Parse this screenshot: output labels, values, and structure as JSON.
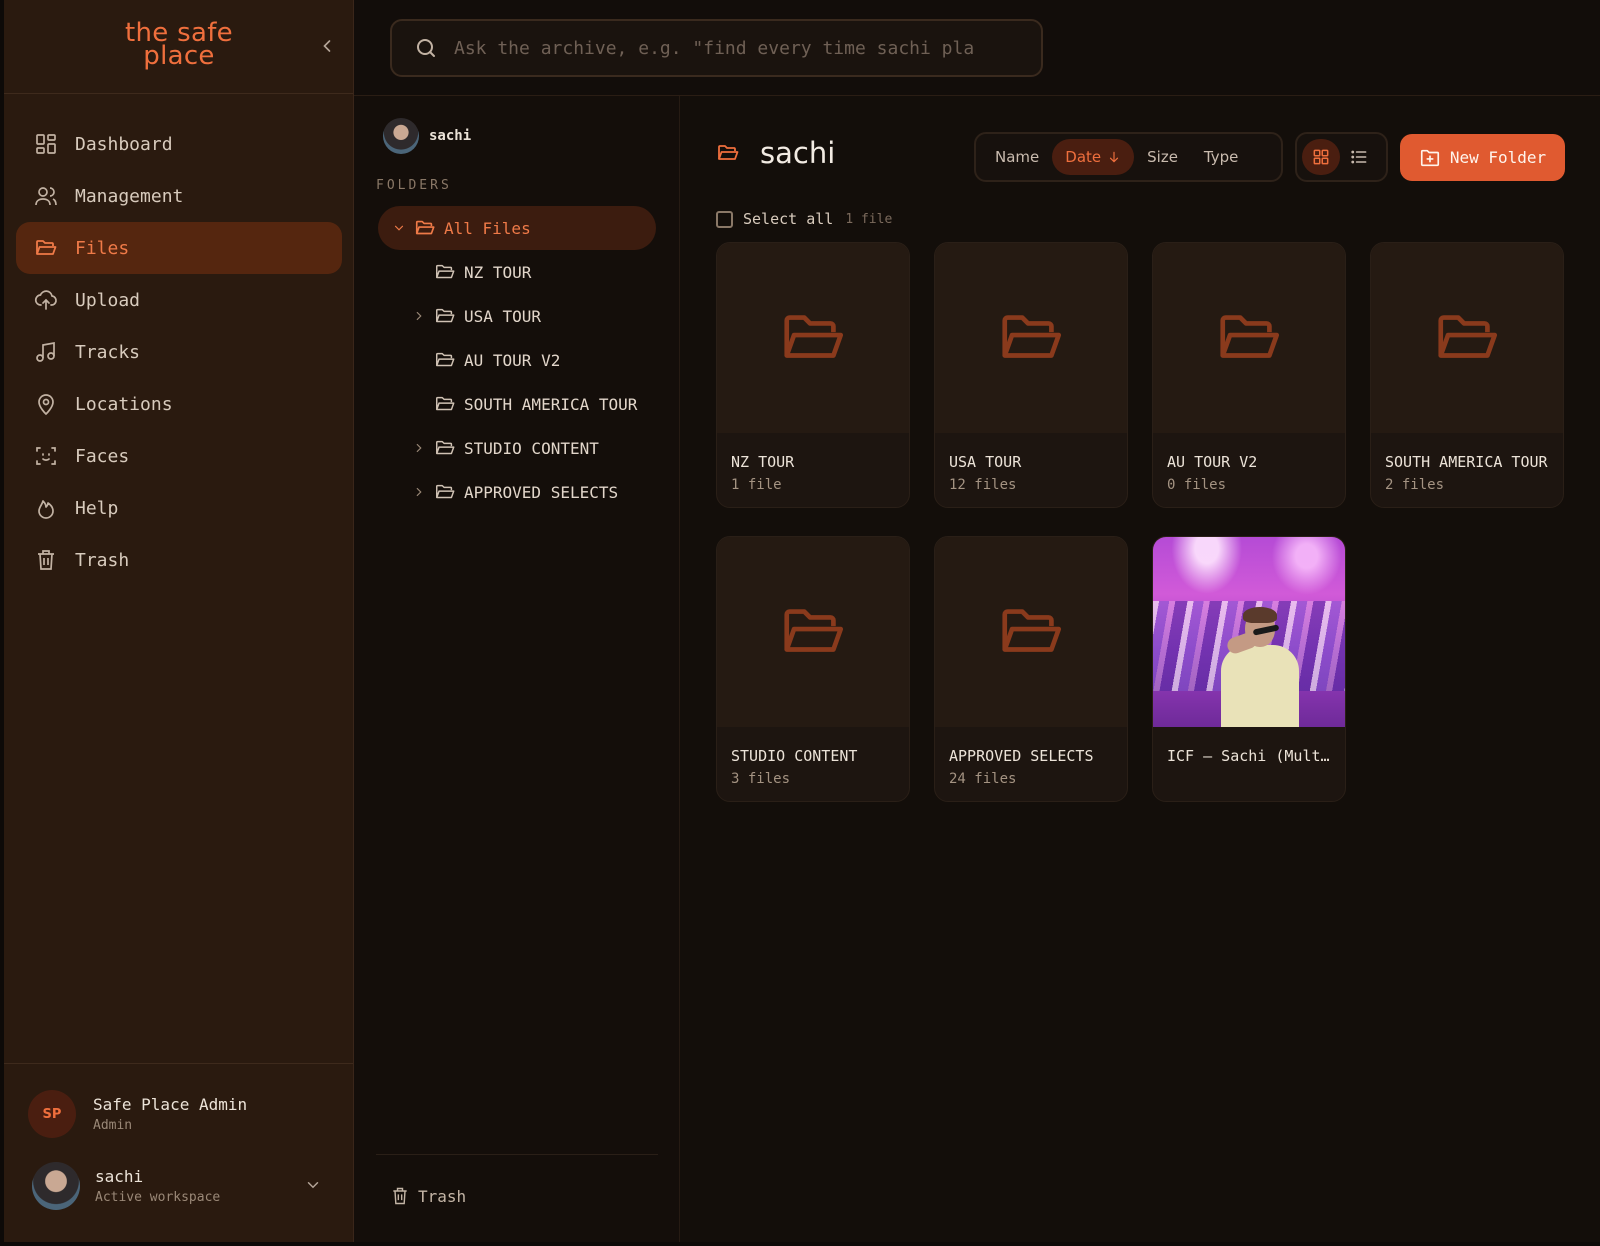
{
  "app": {
    "logo": "the safe place"
  },
  "nav": [
    {
      "label": "Dashboard",
      "icon": "dashboard-icon"
    },
    {
      "label": "Management",
      "icon": "users-icon"
    },
    {
      "label": "Files",
      "icon": "folder-icon",
      "active": true
    },
    {
      "label": "Upload",
      "icon": "cloud-upload-icon"
    },
    {
      "label": "Tracks",
      "icon": "music-note-icon"
    },
    {
      "label": "Locations",
      "icon": "map-pin-icon"
    },
    {
      "label": "Faces",
      "icon": "face-scan-icon"
    },
    {
      "label": "Help",
      "icon": "flame-icon"
    },
    {
      "label": "Trash",
      "icon": "trash-icon"
    }
  ],
  "user": {
    "initials": "SP",
    "name": "Safe Place Admin",
    "role": "Admin"
  },
  "workspace": {
    "name": "sachi",
    "subtitle": "Active workspace"
  },
  "search": {
    "placeholder": "Ask the archive, e.g. \"find every time sachi plа"
  },
  "folders_panel": {
    "owner": "sachi",
    "section_label": "FOLDERS",
    "tree": [
      {
        "label": "All Files",
        "expanded": true,
        "root": true
      },
      {
        "label": "NZ TOUR",
        "has_children": false
      },
      {
        "label": "USA TOUR",
        "has_children": true
      },
      {
        "label": "AU TOUR V2",
        "has_children": false
      },
      {
        "label": "SOUTH AMERICA TOUR",
        "has_children": false
      },
      {
        "label": "STUDIO CONTENT",
        "has_children": true
      },
      {
        "label": "APPROVED SELECTS",
        "has_children": true
      }
    ],
    "trash_label": "Trash"
  },
  "main": {
    "title": "sachi",
    "sort": [
      {
        "label": "Name"
      },
      {
        "label": "Date",
        "active": true,
        "direction": "desc"
      },
      {
        "label": "Size"
      },
      {
        "label": "Type"
      }
    ],
    "view_mode": "grid",
    "new_folder_label": "New Folder",
    "select_all_label": "Select all",
    "selection_count": "1 file",
    "items": [
      {
        "name": "NZ TOUR",
        "count": "1 file",
        "kind": "folder"
      },
      {
        "name": "USA TOUR",
        "count": "12 files",
        "kind": "folder"
      },
      {
        "name": "AU TOUR V2",
        "count": "0 files",
        "kind": "folder"
      },
      {
        "name": "SOUTH AMERICA TOUR",
        "count": "2 files",
        "kind": "folder"
      },
      {
        "name": "STUDIO CONTENT",
        "count": "3 files",
        "kind": "folder"
      },
      {
        "name": "APPROVED SELECTS",
        "count": "24 files",
        "kind": "folder"
      },
      {
        "name": "ICF – Sachi (Mult…",
        "count": "",
        "kind": "image"
      }
    ]
  },
  "colors": {
    "accent": "#e05a30",
    "sidebar": "#2a1a0f",
    "background": "#130e0a"
  }
}
